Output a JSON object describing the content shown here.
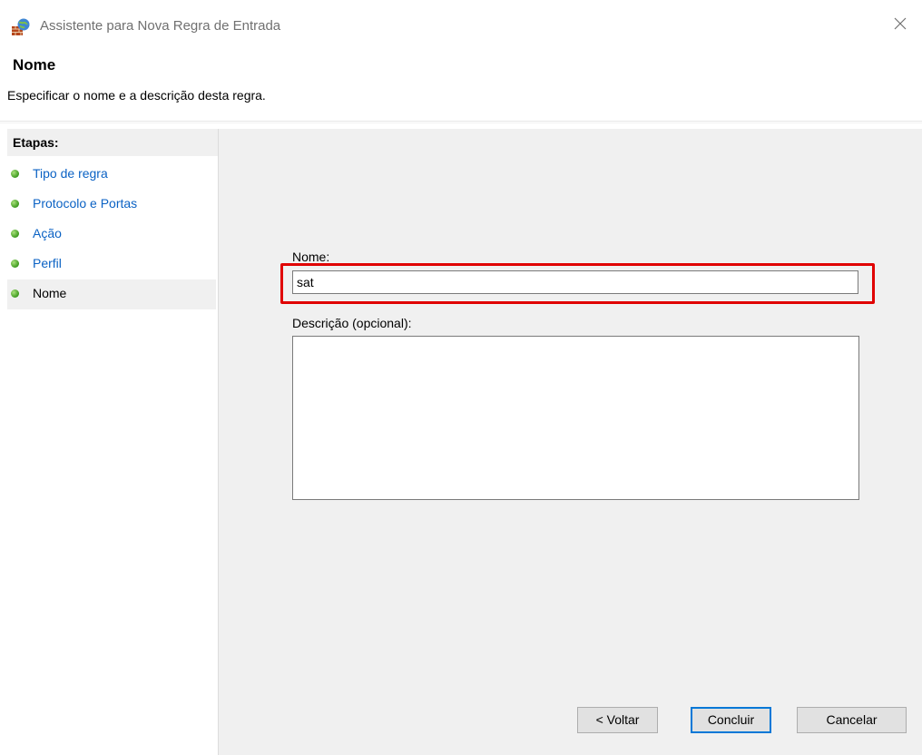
{
  "window": {
    "title": "Assistente para Nova Regra de Entrada"
  },
  "header": {
    "heading": "Nome",
    "subtitle": "Especificar o nome e a descrição desta regra."
  },
  "steps": {
    "header": "Etapas:",
    "items": [
      {
        "label": "Tipo de regra"
      },
      {
        "label": "Protocolo e Portas"
      },
      {
        "label": "Ação"
      },
      {
        "label": "Perfil"
      },
      {
        "label": "Nome"
      }
    ],
    "current_index": 4
  },
  "form": {
    "name_label": "Nome:",
    "name_value": "sat",
    "description_label": "Descrição (opcional):",
    "description_value": ""
  },
  "buttons": {
    "back": "< Voltar",
    "finish": "Concluir",
    "cancel": "Cancelar"
  },
  "colors": {
    "highlight": "#e00000",
    "link": "#0b62c4",
    "primary_border": "#0078d7"
  },
  "icons": {
    "app": "firewall-globe-icon",
    "close": "close-icon",
    "step": "green-dot-icon"
  }
}
